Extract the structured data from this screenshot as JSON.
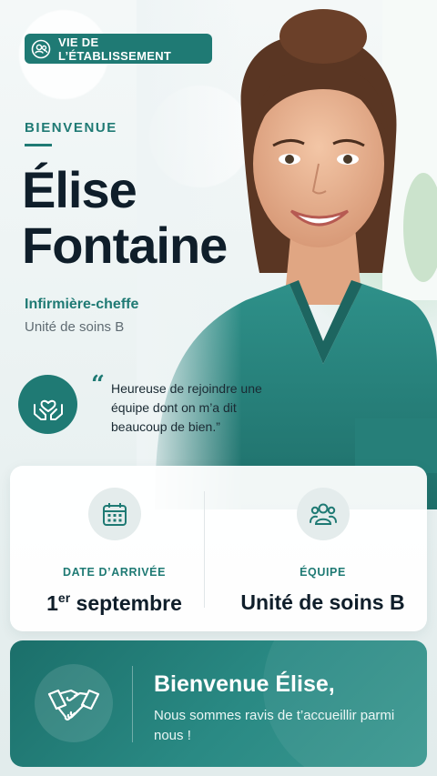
{
  "badge": {
    "label": "VIE DE L’ÉTABLISSEMENT",
    "icon": "people-circle-icon"
  },
  "header": {
    "kicker": "BIENVENUE",
    "first_name": "Élise",
    "last_name": "Fontaine",
    "role": "Infirmière-cheffe",
    "unit": "Unité de soins B"
  },
  "quote": {
    "icon": "heart-hands-icon",
    "mark": "“",
    "text": "Heureuse de rejoindre une équipe dont on m’a dit beaucoup de bien.”"
  },
  "info": {
    "arrival": {
      "icon": "calendar-icon",
      "label": "DATE D’ARRIVÉE",
      "value_day": "1",
      "value_sup": "er",
      "value_month": "septembre"
    },
    "team": {
      "icon": "team-icon",
      "label": "ÉQUIPE",
      "value": "Unité de soins B"
    }
  },
  "welcome": {
    "icon": "handshake-icon",
    "title": "Bienvenue Élise,",
    "text": "Nous sommes ravis de t’accueillir parmi nous !"
  },
  "colors": {
    "accent": "#1f7a74",
    "dark_text": "#0f1e2a",
    "muted": "#5f6b72",
    "scrubs": "#2b8b85"
  }
}
